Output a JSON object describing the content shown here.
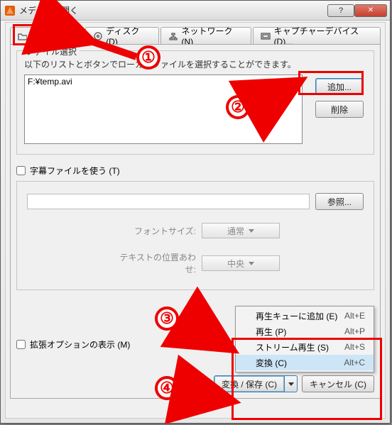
{
  "window": {
    "title": "メディアを開く"
  },
  "tabs": {
    "file": {
      "label": "ファイル (F)"
    },
    "disc": {
      "label": "ディスク (D)"
    },
    "network": {
      "label": "ネットワーク (N)"
    },
    "capture": {
      "label": "キャプチャーデバイス(D)..."
    }
  },
  "fileGroup": {
    "legend": "ファイル選択",
    "hint": "以下のリストとボタンでローカルファイルを選択することができます。",
    "fileItem": "F:¥temp.avi",
    "addBtn": "追加...",
    "removeBtn": "削除"
  },
  "subtitle": {
    "check": "字幕ファイルを使う (T)",
    "browse": "参照..."
  },
  "font": {
    "label": "フォントサイズ:",
    "value": "通常"
  },
  "align": {
    "label": "テキストの位置あわせ:",
    "value": "中央"
  },
  "advanced": {
    "check": "拡張オプションの表示 (M)"
  },
  "footer": {
    "convert": "変換 / 保存 (C)",
    "cancel": "キャンセル (C)"
  },
  "menu": {
    "enqueue": {
      "label": "再生キューに追加 (E)",
      "short": "Alt+E"
    },
    "play": {
      "label": "再生 (P)",
      "short": "Alt+P"
    },
    "stream": {
      "label": "ストリーム再生 (S)",
      "short": "Alt+S"
    },
    "conv": {
      "label": "変換 (C)",
      "short": "Alt+C"
    }
  },
  "annot": {
    "n1": "①",
    "n2": "②",
    "n3": "③",
    "n4": "④"
  }
}
